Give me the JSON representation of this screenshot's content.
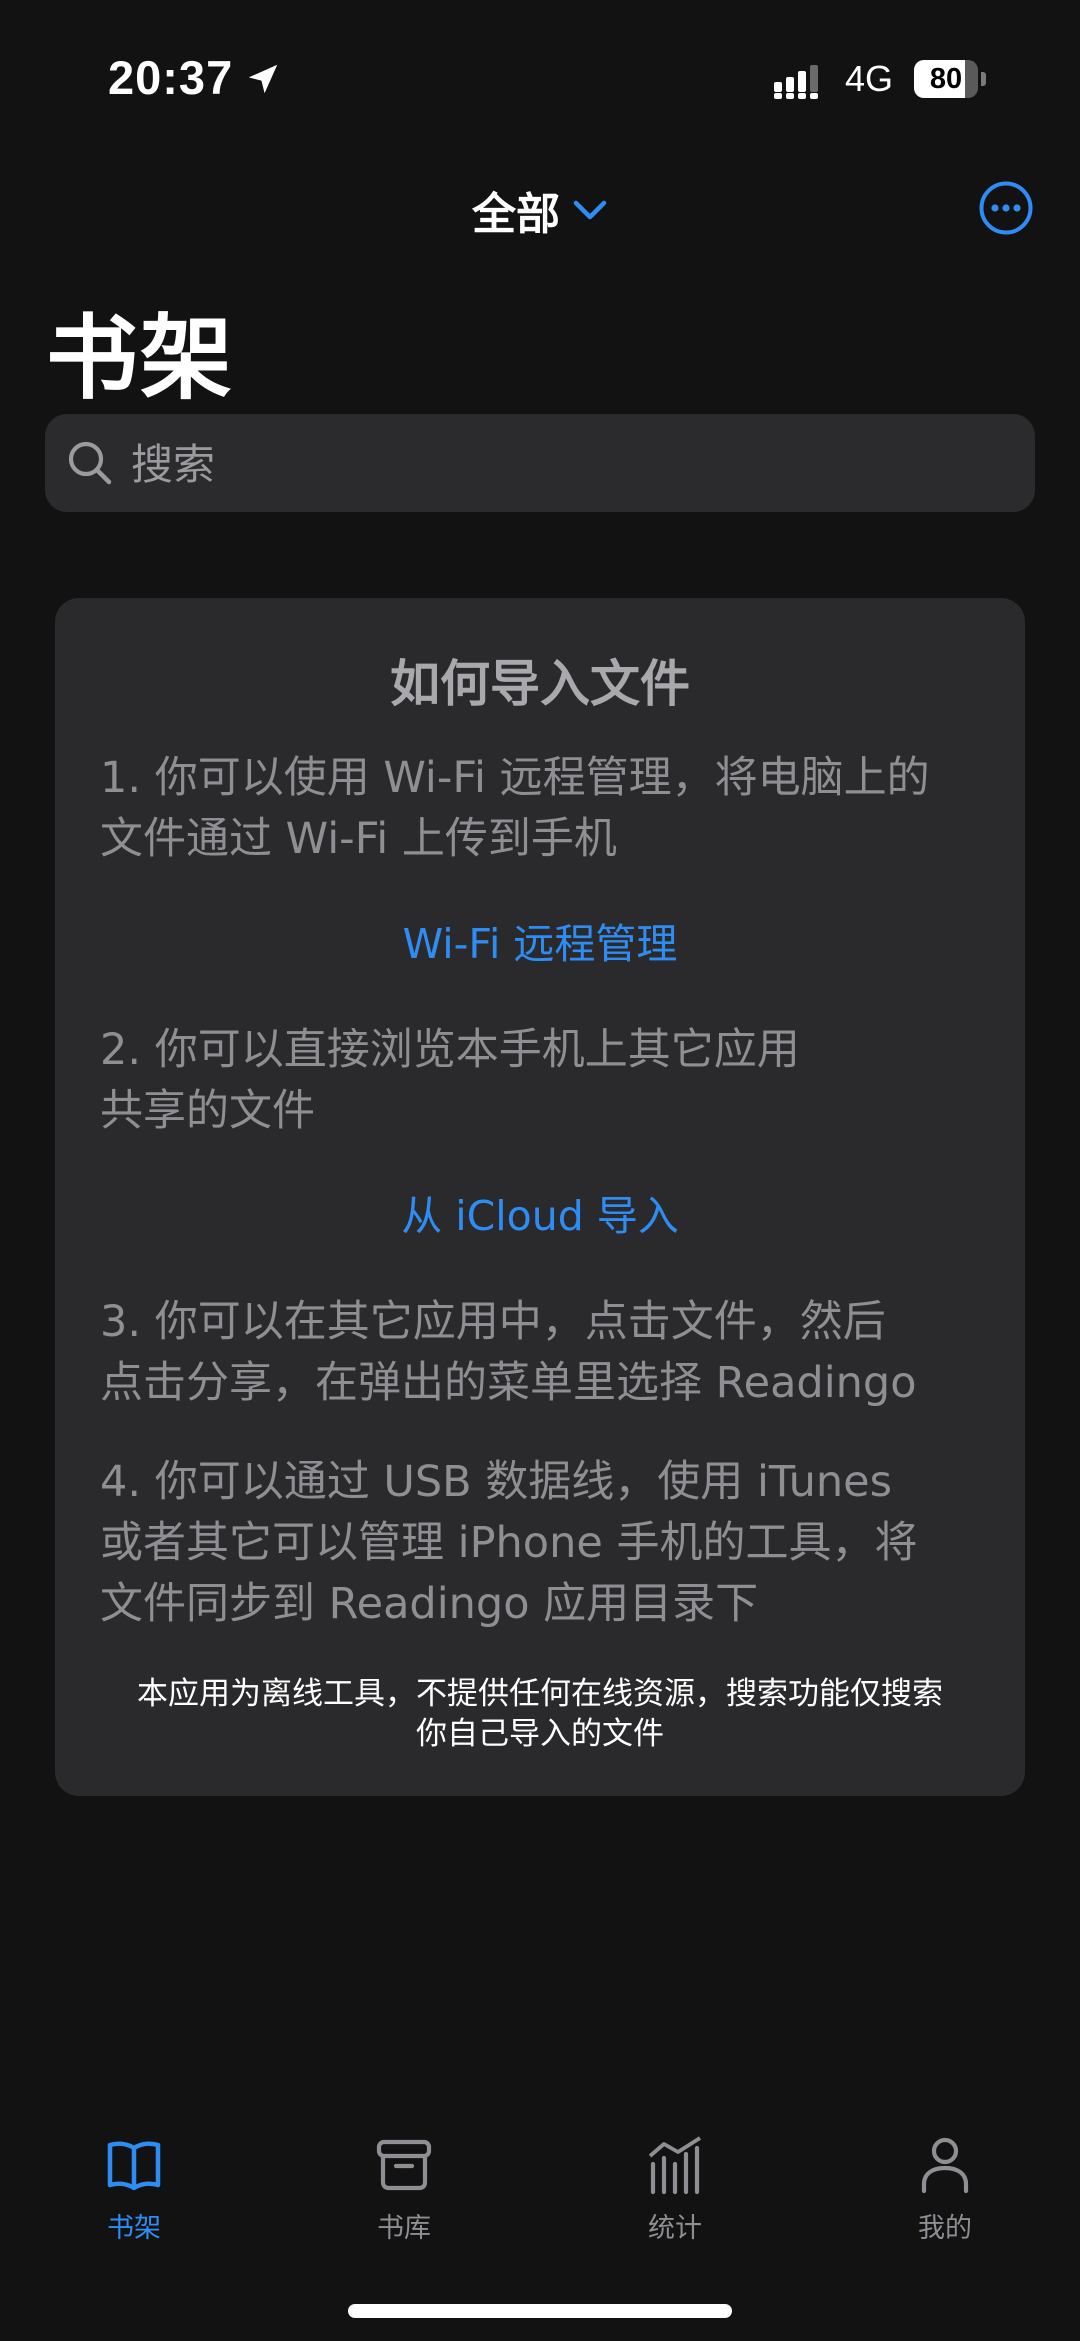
{
  "status_bar": {
    "time": "20:37",
    "network": "4G",
    "battery_level": "80",
    "battery_fraction": 0.8
  },
  "header": {
    "filter_label": "全部",
    "title": "书架"
  },
  "search": {
    "placeholder": "搜索"
  },
  "card": {
    "title": "如何导入文件",
    "step1": [
      "1. 你可以使用 Wi-Fi 远程管理，将电脑上的",
      "文件通过 Wi-Fi 上传到手机"
    ],
    "wifi_link": "Wi-Fi 远程管理",
    "step2": [
      "2. 你可以直接浏览本手机上其它应用",
      "共享的文件"
    ],
    "icloud_link": "从 iCloud 导入",
    "step3": [
      "3. 你可以在其它应用中，点击文件，然后",
      "点击分享，在弹出的菜单里选择 Readingo"
    ],
    "step4": [
      "4. 你可以通过 USB 数据线，使用 iTunes",
      "或者其它可以管理 iPhone 手机的工具，将",
      "文件同步到 Readingo 应用目录下"
    ],
    "note": [
      "本应用为离线工具，不提供任何在线资源，搜索功能仅搜索",
      "你自己导入的文件"
    ]
  },
  "tabs": [
    {
      "label": "书架",
      "icon": "book-icon",
      "active": true
    },
    {
      "label": "书库",
      "icon": "archive-box-icon",
      "active": false
    },
    {
      "label": "统计",
      "icon": "chart-bars-icon",
      "active": false
    },
    {
      "label": "我的",
      "icon": "person-icon",
      "active": false
    }
  ],
  "colors": {
    "background": "#121212",
    "card": "#2a2a2c",
    "accent": "#2f8cf3",
    "secondary_text": "#8e8e93"
  }
}
